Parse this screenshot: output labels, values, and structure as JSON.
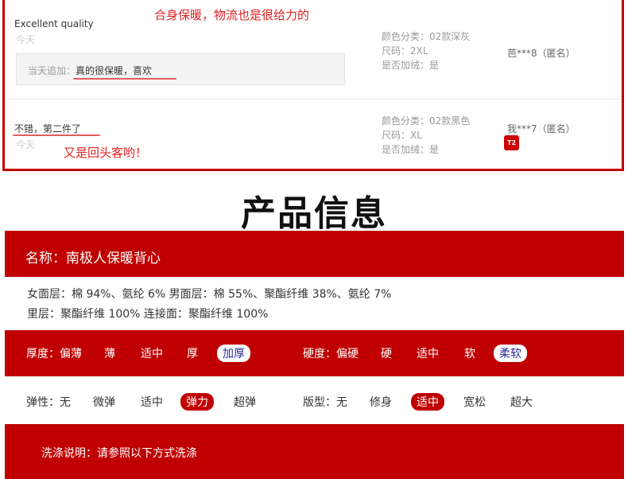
{
  "reviews": [
    {
      "text": "Excellent quality",
      "date": "今天",
      "append_label": "当天追加：",
      "append_text": "真的很保暖，喜欢",
      "meta": [
        "颜色分类：02款深灰",
        "尺码：2XL",
        "是否加绒：是"
      ],
      "user": "芭***8（匿名）",
      "annotation": "合身保暖，物流也是很给力的"
    },
    {
      "text": "不错，第二件了",
      "date": "今天",
      "meta": [
        "颜色分类：02款黑色",
        "尺码：XL",
        "是否加绒：是"
      ],
      "user": "我***7（匿名）",
      "badge": "T2",
      "annotation": "又是回头客哟！"
    }
  ],
  "product_info": {
    "title": "产品信息",
    "name": "名称：南极人保暖背心",
    "materials": [
      "女面层：棉 94%、氨纶 6%  男面层：棉 55%、聚酯纤维 38%、氨纶 7%",
      "里层：聚酯纤维 100%  连接面：聚酯纤维 100%"
    ],
    "thickness": {
      "label": "厚度：偏薄",
      "options": [
        "薄",
        "适中",
        "厚",
        "加厚"
      ],
      "selected": "加厚"
    },
    "hardness": {
      "label": "硬度：偏硬",
      "options": [
        "硬",
        "适中",
        "软",
        "柔软"
      ],
      "selected": "柔软"
    },
    "elasticity": {
      "label": "弹性：无",
      "options": [
        "微弹",
        "适中",
        "弹力",
        "超弹"
      ],
      "selected": "弹力"
    },
    "fit": {
      "label": "版型：无",
      "options": [
        "修身",
        "适中",
        "宽松",
        "超大"
      ],
      "selected": "适中"
    },
    "wash": "洗涤说明：请参照以下方式洗涤"
  },
  "colors": {
    "brand_red": "#c00000",
    "annotation_red": "#e02020",
    "pill_text": "#2a2a9a"
  }
}
